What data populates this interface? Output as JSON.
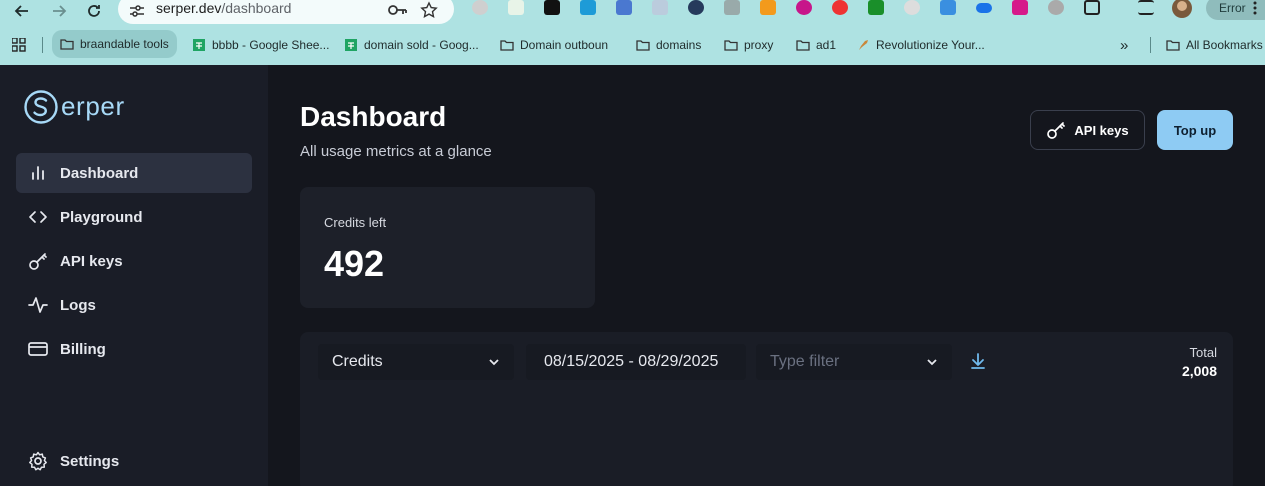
{
  "browser": {
    "url_domain": "serper.dev",
    "url_path": "/dashboard",
    "error_label": "Error",
    "bookmarks": [
      {
        "label": "braandable tools",
        "icon": "folder-icon"
      },
      {
        "label": "bbbb - Google Shee...",
        "icon": "sheets-icon"
      },
      {
        "label": "domain sold - Goog...",
        "icon": "sheets-icon"
      },
      {
        "label": "Domain outboun",
        "icon": "folder-icon"
      },
      {
        "label": "domains",
        "icon": "folder-icon"
      },
      {
        "label": "proxy",
        "icon": "folder-icon"
      },
      {
        "label": "ad1",
        "icon": "folder-icon"
      },
      {
        "label": "Revolutionize Your...",
        "icon": "rocket-icon"
      }
    ],
    "overflow_label": "»",
    "all_bookmarks_label": "All Bookmarks"
  },
  "app": {
    "brand": "erper",
    "sidebar": {
      "items": [
        {
          "label": "Dashboard",
          "icon": "bar-chart-icon",
          "active": true
        },
        {
          "label": "Playground",
          "icon": "code-icon",
          "active": false
        },
        {
          "label": "API keys",
          "icon": "key-icon",
          "active": false
        },
        {
          "label": "Logs",
          "icon": "activity-icon",
          "active": false
        },
        {
          "label": "Billing",
          "icon": "credit-card-icon",
          "active": false
        }
      ],
      "settings_label": "Settings"
    },
    "header": {
      "title": "Dashboard",
      "subtitle": "All usage metrics at a glance",
      "api_keys_label": "API keys",
      "top_up_label": "Top up"
    },
    "credits_card": {
      "label": "Credits left",
      "value": "492"
    },
    "usage_panel": {
      "metric_select": "Credits",
      "date_range": "08/15/2025 - 08/29/2025",
      "type_filter_placeholder": "Type filter",
      "total_label": "Total",
      "total_value": "2,008"
    }
  },
  "colors": {
    "accent": "#8ecbf3",
    "sidebar_bg": "#1a1d27",
    "main_bg": "#14161d",
    "browser_chrome": "#aee2e2"
  }
}
